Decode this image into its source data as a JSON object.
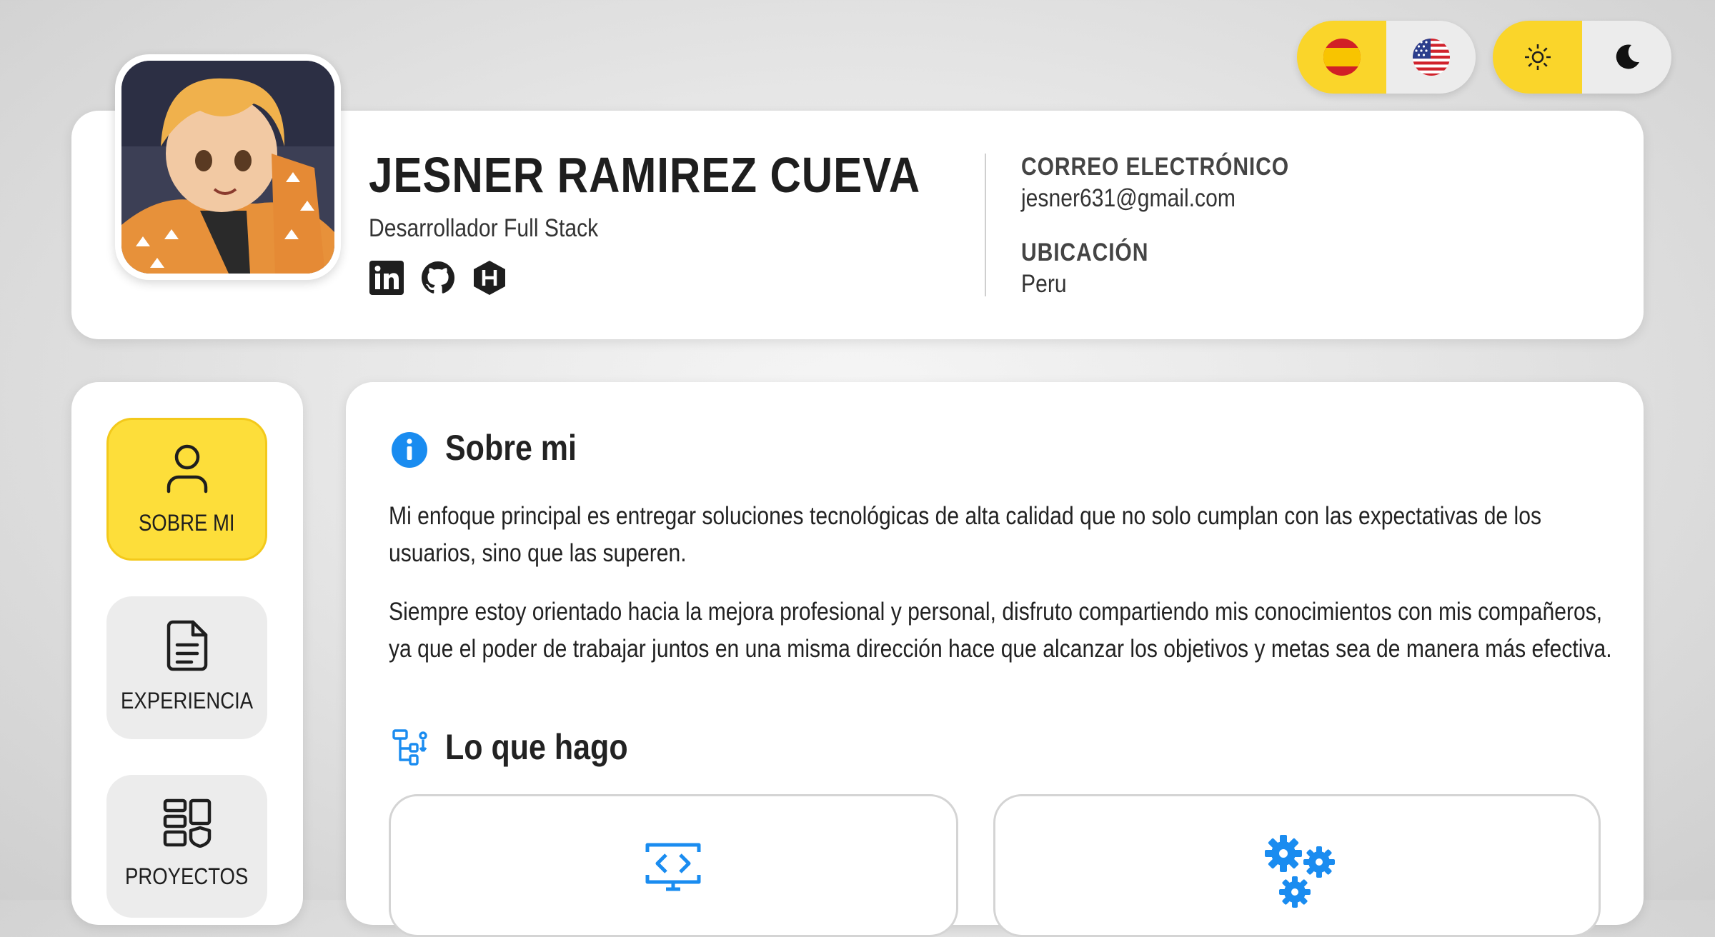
{
  "language_toggle": {
    "options": [
      "es",
      "en"
    ],
    "active": "es"
  },
  "theme_toggle": {
    "options": [
      "light",
      "dark"
    ],
    "active": "light"
  },
  "profile": {
    "name": "JESNER RAMIREZ CUEVA",
    "role": "Desarrollador Full Stack",
    "social": [
      "linkedin",
      "github",
      "hackerrank"
    ]
  },
  "contact": {
    "email_label": "CORREO ELECTRÓNICO",
    "email": "jesner631@gmail.com",
    "location_label": "UBICACIÓN",
    "location": "Peru"
  },
  "sidebar": {
    "items": [
      {
        "label": "SOBRE MI",
        "icon": "user-icon",
        "active": true
      },
      {
        "label": "EXPERIENCIA",
        "icon": "document-icon",
        "active": false
      },
      {
        "label": "PROYECTOS",
        "icon": "projects-icon",
        "active": false
      }
    ]
  },
  "about": {
    "title": "Sobre mi",
    "paragraphs": [
      "Mi enfoque principal es entregar soluciones tecnológicas de alta calidad que no solo cumplan con las expectativas de los usuarios, sino que las superen.",
      "Siempre estoy orientado hacia la mejora profesional y personal, disfruto compartiendo mis conocimientos con mis compañeros, ya que el poder de trabajar juntos en una misma dirección hace que alcanzar los objetivos y metas sea de manera más efectiva."
    ]
  },
  "services": {
    "title": "Lo que hago",
    "cards": [
      {
        "icon": "code-monitor-icon"
      },
      {
        "icon": "gears-icon"
      }
    ]
  },
  "colors": {
    "accent": "#fad52a",
    "blue": "#1a8cf0"
  }
}
